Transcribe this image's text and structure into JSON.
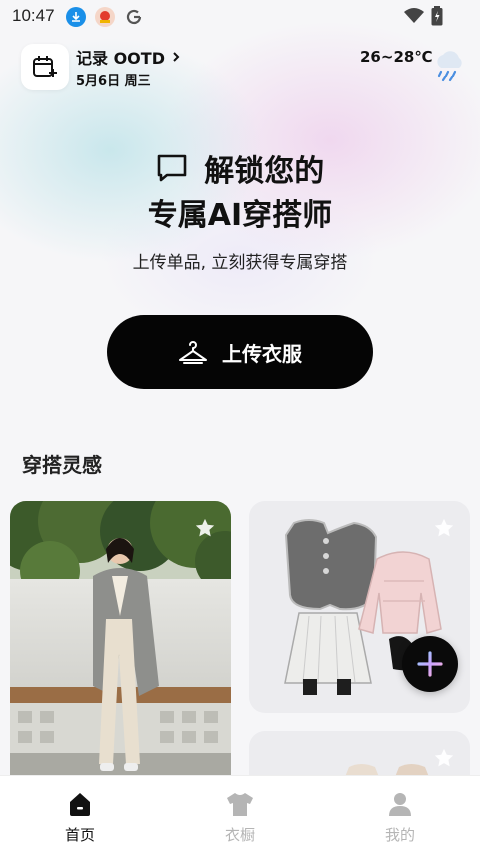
{
  "status_bar": {
    "time": "10:47"
  },
  "header": {
    "record_label": "记录 OOTD",
    "date": "5月6日 周三",
    "temperature": "26~28℃",
    "weather_icon": "rain-cloud-icon"
  },
  "hero": {
    "line1": "解锁您的",
    "line2_prefix": "专属AI穿搭师",
    "subtitle": "上传单品, 立刻获得专属穿搭",
    "upload_button": "上传衣服"
  },
  "inspiration": {
    "title": "穿搭灵感"
  },
  "bottom_nav": [
    {
      "label": "首页",
      "icon": "home-icon",
      "active": true
    },
    {
      "label": "衣橱",
      "icon": "shirt-icon",
      "active": false
    },
    {
      "label": "我的",
      "icon": "profile-icon",
      "active": false
    }
  ],
  "colors": {
    "accent_underline": "#b9a9f4",
    "button_bg": "#050505",
    "nav_active": "#111111",
    "nav_inactive": "#b5b5b5"
  }
}
